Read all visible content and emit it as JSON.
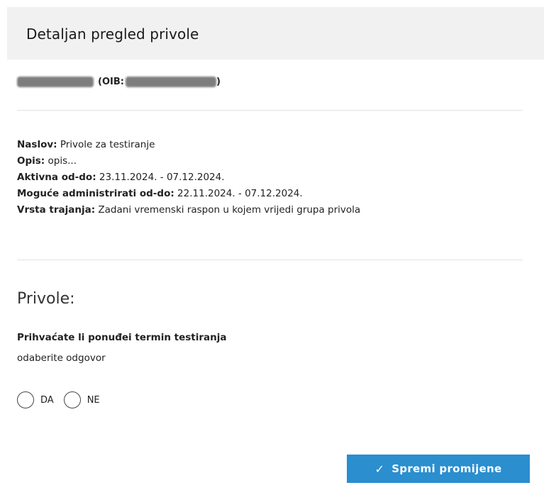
{
  "modal": {
    "title": "Detaljan pregled privole"
  },
  "person": {
    "name_redacted": "",
    "oib_label": "(OIB:",
    "oib_redacted": "",
    "close_paren": ")"
  },
  "info": [
    {
      "label": "Naslov:",
      "value": " Privole za testiranje"
    },
    {
      "label": "Opis:",
      "value": " opis..."
    },
    {
      "label": "Aktivna od-do:",
      "value": " 23.11.2024. - 07.12.2024."
    },
    {
      "label": "Moguće administrirati od-do:",
      "value": " 22.11.2024. - 07.12.2024."
    },
    {
      "label": "Vrsta trajanja:",
      "value": " Zadani vremenski raspon u kojem vrijedi grupa privola"
    }
  ],
  "consents": {
    "section_title": "Privole:",
    "question": "Prihvaćate li ponuđei termin testiranja",
    "hint": "odaberite odgovor",
    "options": [
      {
        "label": "DA",
        "selected": false
      },
      {
        "label": "NE",
        "selected": false
      }
    ]
  },
  "actions": {
    "save_label": "Spremi promijene",
    "save_icon": "check-icon"
  },
  "colors": {
    "accent": "#2a8ecf",
    "header_bg": "#f1f1f1"
  }
}
